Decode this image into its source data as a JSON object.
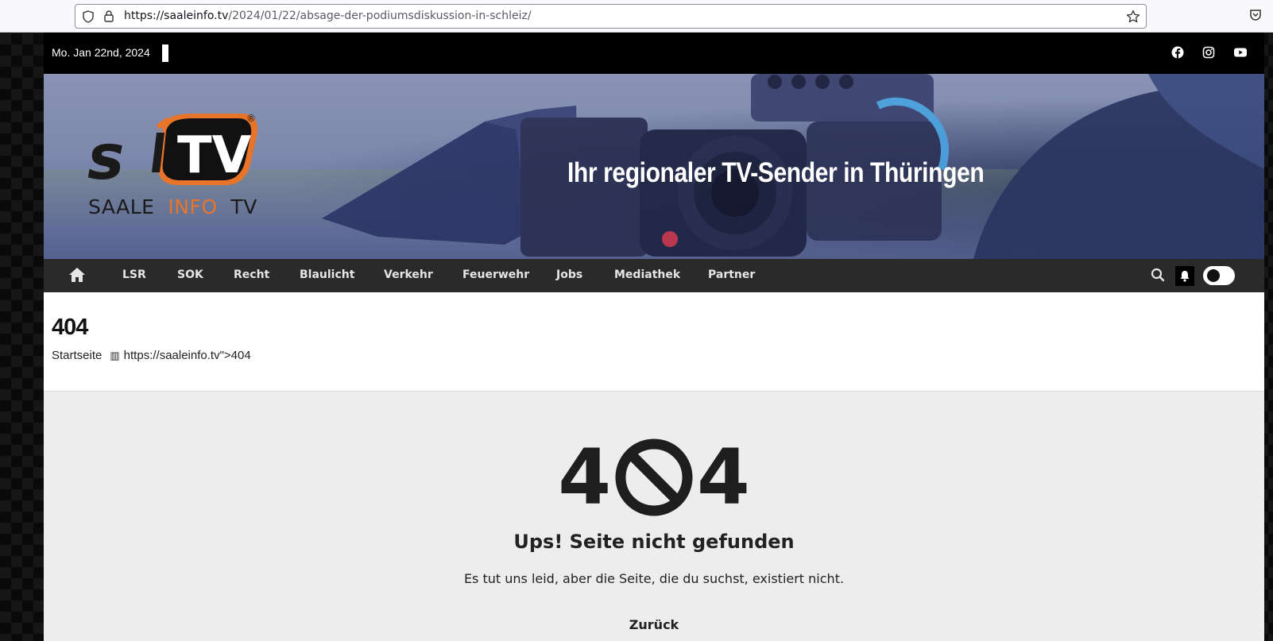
{
  "browser": {
    "url_host": "https://saaleinfo.tv",
    "url_path": "/2024/01/22/absage-der-podiumsdiskussion-in-schleiz/"
  },
  "topbar": {
    "date": "Mo. Jan 22nd, 2024",
    "social": [
      "facebook-icon",
      "instagram-icon",
      "youtube-icon"
    ]
  },
  "banner": {
    "tagline": "Ihr regionaler TV-Sender in Thüringen",
    "logo": {
      "mark": "TV",
      "registered": "®",
      "word1": "SAALE",
      "word2": "INFO",
      "word3": "TV",
      "accent_color": "#e8742a"
    }
  },
  "nav": {
    "items": [
      "LSR",
      "SOK",
      "Recht",
      "Blaulicht",
      "Verkehr",
      "Feuerwehr",
      "Jobs",
      "Mediathek",
      "Partner"
    ]
  },
  "page": {
    "title": "404",
    "breadcrumb_home": "Startseite",
    "breadcrumb_sep": "▥",
    "breadcrumb_current": "https://saaleinfo.tv\">404"
  },
  "error": {
    "digit_left": "4",
    "digit_right": "4",
    "heading": "Ups! Seite nicht gefunden",
    "message": "Es tut uns leid, aber die Seite, die du suchst, existiert nicht.",
    "back_label": "Zurück"
  }
}
